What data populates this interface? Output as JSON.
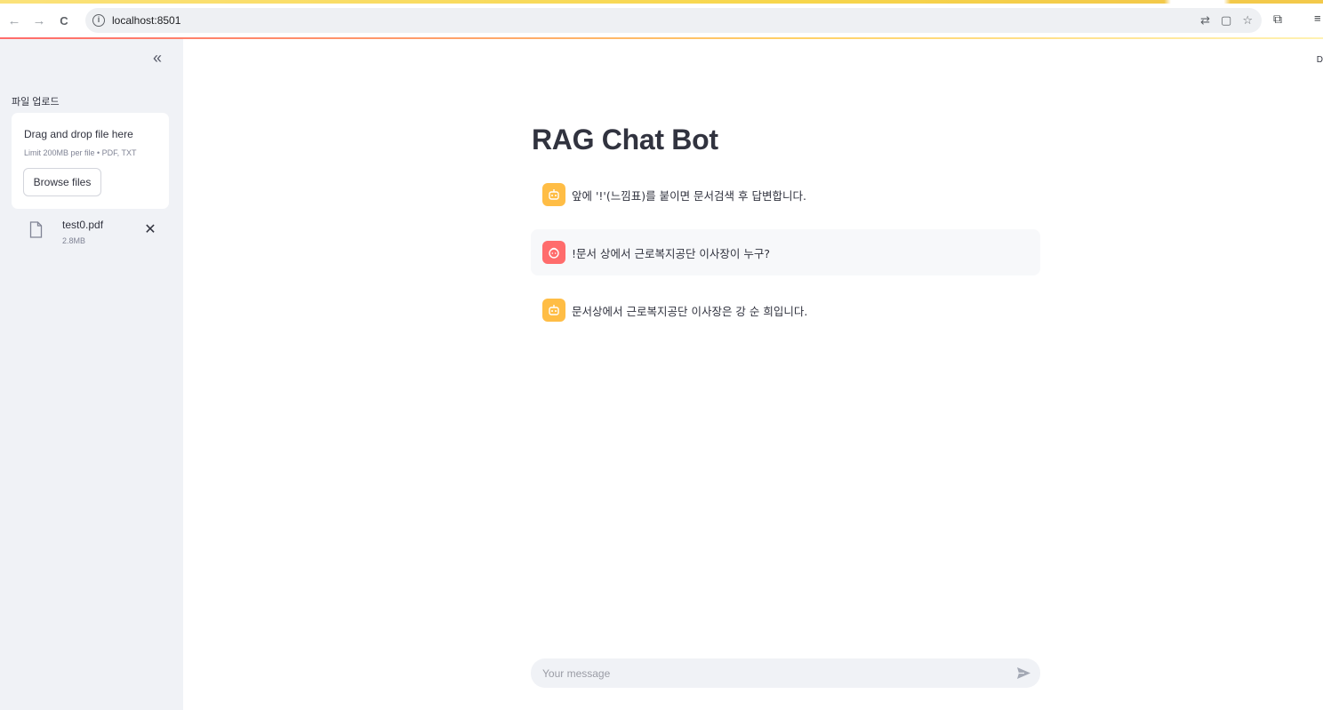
{
  "browser": {
    "url": "localhost:8501",
    "info_glyph": "i",
    "back_glyph": "←",
    "forward_glyph": "→",
    "reload_glyph": "C",
    "address_icons": [
      "translate-icon",
      "page-icon",
      "star-icon"
    ],
    "translate_glyph": "⇄",
    "page_glyph": "▢",
    "star_glyph": "☆",
    "extensions_glyph": "⧉",
    "menu_glyph": "≡"
  },
  "sidebar": {
    "collapse_glyph": "«",
    "upload_label": "파일 업로드",
    "dropzone": {
      "title": "Drag and drop file here",
      "limit": "Limit 200MB per file • PDF, TXT",
      "browse_label": "Browse files"
    },
    "file": {
      "name": "test0.pdf",
      "size": "2.8MB",
      "remove_glyph": "✕"
    }
  },
  "main": {
    "deploy_hint": "D",
    "title": "RAG Chat Bot",
    "messages": [
      {
        "role": "assistant",
        "text": "앞에 '!'(느낌표)를 붙이면 문서검색 후 답변합니다."
      },
      {
        "role": "user",
        "text": "!문서 상에서 근로복지공단 이사장이 누구?"
      },
      {
        "role": "assistant",
        "text": "문서상에서 근로복지공단 이사장은 강 순 희입니다."
      }
    ],
    "input_placeholder": "Your message"
  },
  "colors": {
    "bot_avatar": "#ffbd45",
    "user_avatar": "#ff6c6c",
    "sidebar_bg": "#f0f2f6",
    "text": "#31333f"
  }
}
